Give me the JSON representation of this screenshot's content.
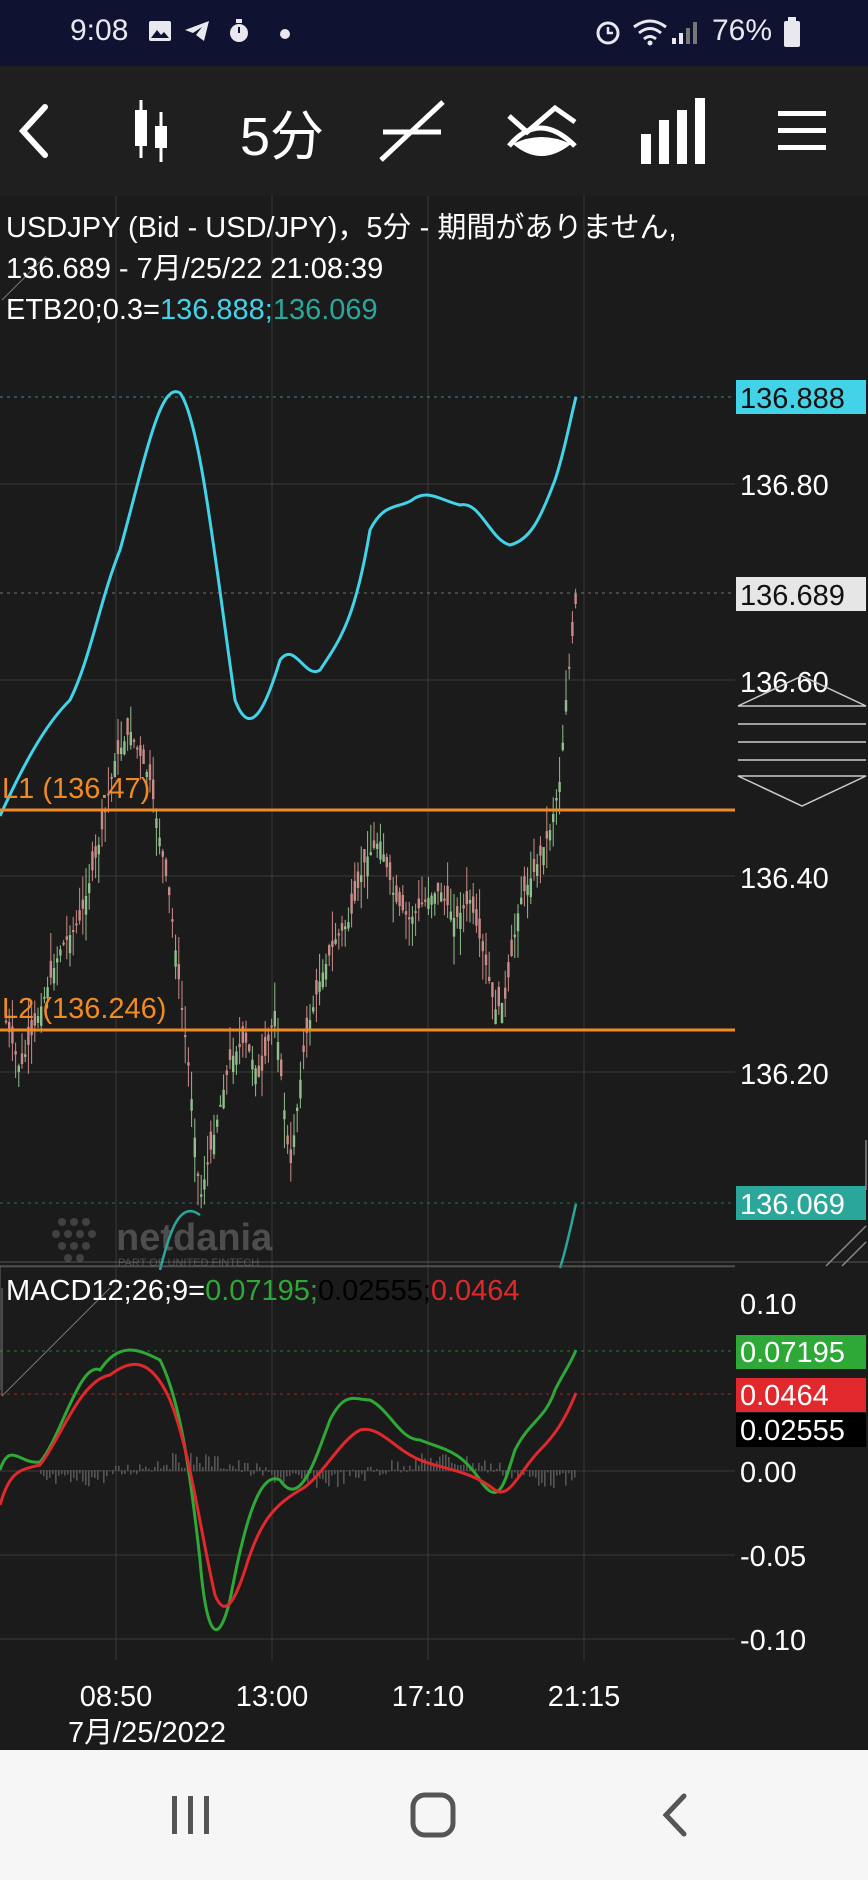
{
  "status_bar": {
    "time": "9:08",
    "battery_percent": "76%",
    "icons": [
      "image-icon",
      "telegram-icon",
      "timer-icon",
      "dot-icon",
      "alarm-icon",
      "wifi-icon",
      "signal-icon",
      "battery-icon"
    ]
  },
  "toolbar": {
    "back_icon": "chevron-left-icon",
    "chart_type_icon": "candlestick-icon",
    "interval_label": "5分",
    "draw_icon": "trendline-icon",
    "indicator_icon": "indicator-icon",
    "studies_icon": "bar-chart-icon",
    "menu_icon": "hamburger-menu-icon"
  },
  "header": {
    "line1": "USDJPY (Bid - USD/JPY)，5分 - 期間がありません,",
    "line2": "136.689 - 7月/25/22 21:08:39",
    "etb_prefix": "ETB20;0.3=",
    "etb_upper": "136.888;",
    "etb_lower": "136.069"
  },
  "lines": {
    "l1": "L1 (136.47)",
    "l2": "L2 (136.246)"
  },
  "watermark": {
    "name": "netdania",
    "tagline": "PART OF UNITED FINTECH"
  },
  "macd": {
    "label_prefix": "MACD12;26;9=",
    "macd_value": "0.07195;",
    "signal_value": "0.02555;",
    "hist_value": "0.0464"
  },
  "price_axis": {
    "ticks": [
      "136.80",
      "136.60",
      "136.40",
      "136.20"
    ],
    "tag_upper": "136.888",
    "tag_last": "136.689",
    "tag_lower": "136.069"
  },
  "macd_axis": {
    "ticks": [
      "0.10",
      "0.00",
      "-0.05",
      "-0.10"
    ],
    "tag_macd": "0.07195",
    "tag_hist": "0.0464",
    "tag_signal": "0.02555"
  },
  "time_axis": {
    "ticks": [
      "08:50",
      "13:00",
      "17:10",
      "21:15"
    ],
    "date": "7月/25/2022"
  },
  "colors": {
    "background": "#1b1b1b",
    "cyan": "#43d3e8",
    "teal": "#2aa79a",
    "orange": "#f08a24",
    "green": "#2ea836",
    "red": "#e0282d",
    "candle_up": "#8fbf8a",
    "candle_down": "#c98c88"
  },
  "chart_data": {
    "type": "line",
    "title": "USDJPY (Bid - USD/JPY)，5分 - 期間がありません,",
    "x": [
      "08:50",
      "13:00",
      "17:10",
      "21:15"
    ],
    "last_price": 136.689,
    "ylim": [
      136.06,
      136.91
    ],
    "series": [
      {
        "name": "ETB20;0.3 upper",
        "values": [
          136.5,
          136.82,
          136.88,
          136.6,
          136.62,
          136.75,
          136.79,
          136.72,
          136.88
        ]
      },
      {
        "name": "L1 (136.47)",
        "values": [
          136.47,
          136.47
        ]
      },
      {
        "name": "L2 (136.246)",
        "values": [
          136.246,
          136.246
        ]
      }
    ],
    "price_ticks": [
      136.8,
      136.6,
      136.4,
      136.2
    ],
    "macd": {
      "macd_value": 0.07195,
      "signal_value": 0.02555,
      "histogram_value": 0.0464,
      "ylim": [
        -0.11,
        0.11
      ],
      "ticks": [
        0.1,
        0.0,
        -0.05,
        -0.1
      ]
    },
    "grid": true
  }
}
